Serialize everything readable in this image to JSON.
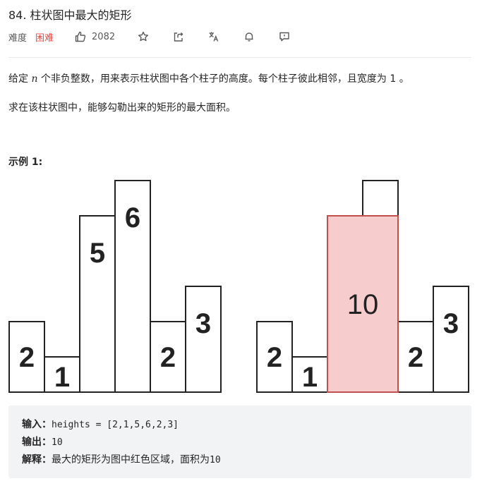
{
  "problem": {
    "title": "84. 柱状图中最大的矩形",
    "difficulty_label": "难度",
    "difficulty": "困难",
    "likes": "2082",
    "toolbar_icons": [
      "thumbs-up-icon",
      "star-icon",
      "share-icon",
      "translate-icon",
      "bell-icon",
      "comment-icon"
    ]
  },
  "description": {
    "line1_pre": "给定 ",
    "line1_var": "n",
    "line1_post": " 个非负整数，用来表示柱状图中各个柱子的高度。每个柱子彼此相邻，且宽度为 1 。",
    "line2": "求在该柱状图中，能够勾勒出来的矩形的最大面积。"
  },
  "example": {
    "title": "示例 1:",
    "input_label": "输入：",
    "input_value": "heights = [2,1,5,6,2,3]",
    "output_label": "输出：",
    "output_value": "10",
    "explain_label": "解释：",
    "explain_text": "最大的矩形为图中红色区域，面积为 ",
    "explain_value": "10"
  },
  "chart_data": [
    {
      "type": "bar",
      "categories": [
        "",
        "",
        "",
        "",
        "",
        ""
      ],
      "values": [
        2,
        1,
        5,
        6,
        2,
        3
      ],
      "labels": [
        "2",
        "1",
        "5",
        "6",
        "2",
        "3"
      ]
    },
    {
      "type": "bar",
      "categories": [
        "",
        "",
        "",
        "",
        "",
        ""
      ],
      "values": [
        2,
        1,
        5,
        6,
        2,
        3
      ],
      "labels": [
        "2",
        "1",
        "",
        "",
        "2",
        "3"
      ],
      "highlight": {
        "start_index": 2,
        "end_index": 3,
        "height": 5,
        "label": "10",
        "color": "#f7cccc",
        "border_color": "#c0504d"
      }
    }
  ],
  "colors": {
    "difficulty": "#ef4743",
    "highlight_fill": "#f7cccc",
    "highlight_border": "#c0504d"
  }
}
